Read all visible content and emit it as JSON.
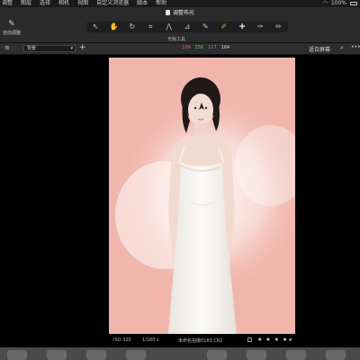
{
  "menubar": {
    "items": [
      "调整",
      "图层",
      "选择",
      "相机",
      "视图",
      "自定义浏览器",
      "脚本",
      "帮助"
    ],
    "battery": "100%"
  },
  "toolbar": {
    "document_title": "调整布光",
    "tools_label": "光标工具",
    "auto_adjust_label": "自动调整",
    "tools": [
      {
        "name": "pointer-tool",
        "glyph": "↖"
      },
      {
        "name": "pan-tool",
        "glyph": "✋"
      },
      {
        "name": "rotate-tool",
        "glyph": "↻"
      },
      {
        "name": "crop-tool",
        "glyph": "⌗"
      },
      {
        "name": "keystone-tool",
        "glyph": "⋀"
      },
      {
        "name": "straighten-tool",
        "glyph": "⊿"
      },
      {
        "name": "eyedropper-tool",
        "glyph": "✎"
      },
      {
        "name": "brush-tool",
        "glyph": "✐",
        "active": true
      },
      {
        "name": "heal-tool",
        "glyph": "✚"
      },
      {
        "name": "gradient-tool",
        "glyph": "✑"
      },
      {
        "name": "erase-tool",
        "glyph": "✏"
      }
    ]
  },
  "subbar": {
    "layer_name": "背景",
    "rgb": [
      "199",
      "156",
      "117",
      "164"
    ],
    "rgb_colors": [
      "#e05c5c",
      "#5ccc5c",
      "#5c8ce0",
      "#dddddd"
    ],
    "fit_label": "适合屏幕"
  },
  "status": {
    "iso": "ISO 320",
    "shutter": "1/160 s",
    "filename": "未命名拍摄0183.CR2",
    "stars": "★ ★ ★ ★ ·"
  },
  "colors": {
    "photo_background": "#f0b6ac",
    "dress": "#f6f4f1",
    "accent": "#f29a3a"
  }
}
